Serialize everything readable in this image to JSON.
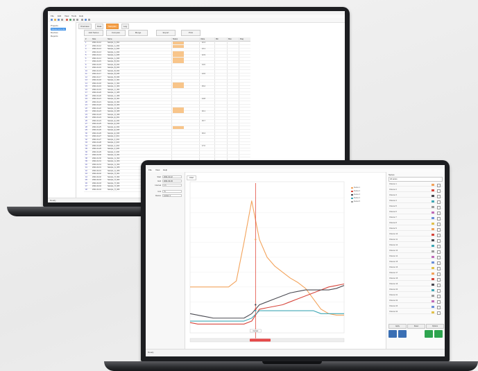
{
  "back_app": {
    "menu": [
      "File",
      "Edit",
      "View",
      "Tools",
      "Help"
    ],
    "tree": [
      {
        "label": "Projects",
        "selected": false
      },
      {
        "label": "Measurements",
        "selected": true
      },
      {
        "label": "Devices",
        "selected": false
      },
      {
        "label": "Reports",
        "selected": false
      }
    ],
    "tabs": [
      {
        "label": "Overview",
        "active": false
      },
      {
        "label": "Data",
        "active": false
      },
      {
        "label": "Samples",
        "active": true
      },
      {
        "label": "Log",
        "active": false
      }
    ],
    "buttons": [
      "Add Series",
      "Compare",
      "Merge",
      "Export",
      "Print"
    ],
    "columns": [
      "#",
      "Date",
      "Name",
      "Status",
      "Value",
      "Min",
      "Max",
      "Flag"
    ],
    "rows": [
      {
        "n": "1",
        "date": "2021-01-12",
        "name": "Sample_A_001",
        "v": "12.4",
        "flag": true
      },
      {
        "n": "2",
        "date": "2021-01-12",
        "name": "Sample_A_002",
        "v": "",
        "flag": true
      },
      {
        "n": "3",
        "date": "2021-01-13",
        "name": "Sample_A_003",
        "v": "13.1",
        "flag": false
      },
      {
        "n": "4",
        "date": "2021-01-13",
        "name": "Sample_A_004",
        "v": "",
        "flag": true
      },
      {
        "n": "5",
        "date": "2021-01-14",
        "name": "Sample_A_005",
        "v": "12.9",
        "flag": true
      },
      {
        "n": "6",
        "date": "2021-01-14",
        "name": "Sample_A_006",
        "v": "",
        "flag": true
      },
      {
        "n": "7",
        "date": "2021-01-15",
        "name": "Sample_B_001",
        "v": "",
        "flag": true
      },
      {
        "n": "8",
        "date": "2021-01-15",
        "name": "Sample_B_002",
        "v": "14.0",
        "flag": false
      },
      {
        "n": "9",
        "date": "2021-01-16",
        "name": "Sample_B_003",
        "v": "",
        "flag": false
      },
      {
        "n": "10",
        "date": "2021-01-16",
        "name": "Sample_B_004",
        "v": "",
        "flag": false
      },
      {
        "n": "11",
        "date": "2021-01-17",
        "name": "Sample_B_005",
        "v": "13.6",
        "flag": false
      },
      {
        "n": "12",
        "date": "2021-01-17",
        "name": "Sample_B_006",
        "v": "",
        "flag": false
      },
      {
        "n": "13",
        "date": "2021-01-18",
        "name": "Sample_C_001",
        "v": "",
        "flag": false
      },
      {
        "n": "14",
        "date": "2021-01-18",
        "name": "Sample_C_002",
        "v": "",
        "flag": true
      },
      {
        "n": "15",
        "date": "2021-01-19",
        "name": "Sample_C_003",
        "v": "15.2",
        "flag": true
      },
      {
        "n": "16",
        "date": "2021-01-19",
        "name": "Sample_C_004",
        "v": "",
        "flag": false
      },
      {
        "n": "17",
        "date": "2021-01-20",
        "name": "Sample_C_005",
        "v": "",
        "flag": false
      },
      {
        "n": "18",
        "date": "2021-01-20",
        "name": "Sample_C_006",
        "v": "",
        "flag": false
      },
      {
        "n": "19",
        "date": "2021-01-21",
        "name": "Sample_D_001",
        "v": "14.8",
        "flag": false
      },
      {
        "n": "20",
        "date": "2021-01-21",
        "name": "Sample_D_002",
        "v": "",
        "flag": false
      },
      {
        "n": "21",
        "date": "2021-01-22",
        "name": "Sample_D_003",
        "v": "",
        "flag": false
      },
      {
        "n": "22",
        "date": "2021-01-22",
        "name": "Sample_D_004",
        "v": "",
        "flag": true
      },
      {
        "n": "23",
        "date": "2021-01-23",
        "name": "Sample_D_005",
        "v": "16.1",
        "flag": true
      },
      {
        "n": "24",
        "date": "2021-01-23",
        "name": "Sample_D_006",
        "v": "",
        "flag": false
      },
      {
        "n": "25",
        "date": "2021-01-24",
        "name": "Sample_E_001",
        "v": "",
        "flag": false
      },
      {
        "n": "26",
        "date": "2021-01-24",
        "name": "Sample_E_002",
        "v": "15.7",
        "flag": false
      },
      {
        "n": "27",
        "date": "2021-01-25",
        "name": "Sample_E_003",
        "v": "",
        "flag": false
      },
      {
        "n": "28",
        "date": "2021-01-25",
        "name": "Sample_E_004",
        "v": "",
        "flag": true
      },
      {
        "n": "29",
        "date": "2021-01-26",
        "name": "Sample_E_005",
        "v": "",
        "flag": false
      },
      {
        "n": "30",
        "date": "2021-01-26",
        "name": "Sample_E_006",
        "v": "16.4",
        "flag": false
      },
      {
        "n": "31",
        "date": "2021-01-27",
        "name": "Sample_F_001",
        "v": "",
        "flag": false
      },
      {
        "n": "32",
        "date": "2021-01-27",
        "name": "Sample_F_002",
        "v": "",
        "flag": false
      },
      {
        "n": "33",
        "date": "2021-01-28",
        "name": "Sample_F_003",
        "v": "",
        "flag": false
      },
      {
        "n": "34",
        "date": "2021-01-28",
        "name": "Sample_F_004",
        "v": "17.0",
        "flag": false
      },
      {
        "n": "35",
        "date": "2021-01-29",
        "name": "Sample_F_005",
        "v": "",
        "flag": false
      },
      {
        "n": "36",
        "date": "2021-01-29",
        "name": "Sample_F_006",
        "v": "",
        "flag": false
      },
      {
        "n": "37",
        "date": "2021-01-30",
        "name": "Sample_G_001",
        "v": "",
        "flag": false
      },
      {
        "n": "38",
        "date": "2021-01-30",
        "name": "Sample_G_002",
        "v": "",
        "flag": false
      },
      {
        "n": "39",
        "date": "2021-01-31",
        "name": "Sample_G_003",
        "v": "",
        "flag": false
      },
      {
        "n": "40",
        "date": "2021-01-31",
        "name": "Sample_G_004",
        "v": "",
        "flag": false
      },
      {
        "n": "41",
        "date": "2021-02-01",
        "name": "Sample_G_005",
        "v": "",
        "flag": false
      },
      {
        "n": "42",
        "date": "2021-02-01",
        "name": "Sample_G_006",
        "v": "",
        "flag": false
      },
      {
        "n": "43",
        "date": "2021-02-02",
        "name": "Sample_H_001",
        "v": "",
        "flag": false
      },
      {
        "n": "44",
        "date": "2021-02-02",
        "name": "Sample_H_002",
        "v": "",
        "flag": false
      },
      {
        "n": "45",
        "date": "2021-02-03",
        "name": "Sample_H_003",
        "v": "",
        "flag": false
      },
      {
        "n": "46",
        "date": "2021-02-03",
        "name": "Sample_H_004",
        "v": "",
        "flag": false
      },
      {
        "n": "47",
        "date": "2021-02-04",
        "name": "Sample_H_005",
        "v": "",
        "flag": false
      },
      {
        "n": "48",
        "date": "2021-02-04",
        "name": "Sample_H_006",
        "v": "",
        "flag": false
      }
    ],
    "status": "Ready"
  },
  "front_app": {
    "menu": [
      "File",
      "View",
      "Help"
    ],
    "fields": [
      {
        "label": "Start",
        "value": "2021-01-12"
      },
      {
        "label": "End",
        "value": "2021-02-04"
      },
      {
        "label": "Interval",
        "value": "1 h"
      },
      {
        "label": "Unit",
        "value": "°C"
      },
      {
        "label": "Device",
        "value": "Logger 1"
      }
    ],
    "chart_tab": "Chart",
    "legend": [
      "Series 1",
      "Series 2",
      "Series 3",
      "Series 4",
      "Series 5"
    ],
    "right_panel": {
      "header": "Series",
      "select": "All series",
      "rows": [
        "Channel 1",
        "Channel 2",
        "Channel 3",
        "Channel 4",
        "Channel 5",
        "Channel 6",
        "Channel 7",
        "Channel 8",
        "Channel 9",
        "Channel 10",
        "Channel 11",
        "Channel 12",
        "Channel 13",
        "Channel 14",
        "Channel 15",
        "Channel 16",
        "Channel 17",
        "Channel 18",
        "Channel 19",
        "Channel 20",
        "Channel 21",
        "Channel 22",
        "Channel 23",
        "Channel 24"
      ],
      "buttons": [
        "Apply",
        "Reset",
        "Options"
      ]
    },
    "status": "Ready",
    "cursor_label": "Cursor",
    "colors": {
      "orange": "#f3a35b",
      "red": "#d7463c",
      "teal": "#3fa7b5",
      "dark": "#4a4a52",
      "accent": "#3a8ee6",
      "green": "#2ea44f"
    }
  },
  "chart_data": {
    "type": "line",
    "x": [
      0,
      1,
      2,
      3,
      4,
      5,
      6,
      7,
      8,
      9,
      10,
      11,
      12,
      13,
      14,
      15,
      16,
      17,
      18,
      19,
      20
    ],
    "series": [
      {
        "color": "#f3a35b",
        "values": [
          30,
          30,
          30,
          30,
          30,
          30,
          34,
          60,
          88,
          62,
          50,
          44,
          40,
          36,
          33,
          29,
          22,
          15,
          12,
          11,
          11
        ]
      },
      {
        "color": "#d7463c",
        "values": [
          6,
          5,
          5,
          5,
          5,
          5,
          5,
          5,
          7,
          15,
          16,
          17,
          18,
          20,
          22,
          24,
          26,
          28,
          30,
          31,
          32
        ]
      },
      {
        "color": "#4a4a52",
        "values": [
          12,
          11,
          10,
          9,
          9,
          9,
          9,
          9,
          12,
          18,
          20,
          22,
          24,
          26,
          27,
          28,
          28,
          28,
          28,
          29,
          31
        ]
      },
      {
        "color": "#3fa7b5",
        "values": [
          7,
          7,
          7,
          7,
          7,
          7,
          7,
          7,
          9,
          14,
          14,
          14,
          14,
          14,
          14,
          14,
          14,
          12,
          12,
          12,
          12
        ]
      }
    ],
    "ylim": [
      0,
      100
    ],
    "xlim": [
      0,
      20
    ],
    "cursor_x": 8.5,
    "grid": true
  }
}
